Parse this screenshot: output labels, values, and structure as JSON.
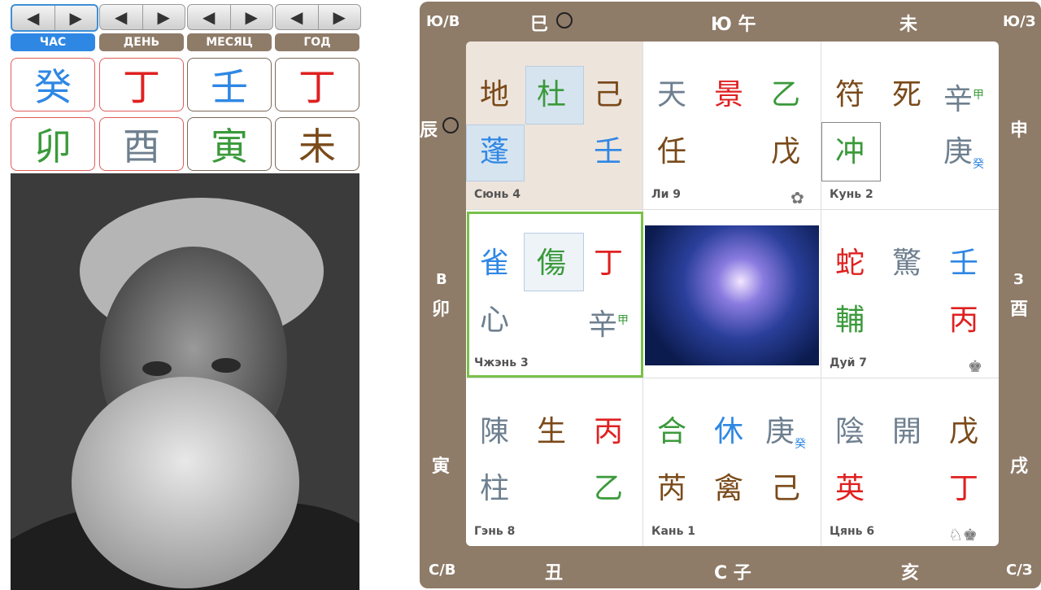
{
  "controls": {
    "tabs": [
      "ЧАС",
      "ДЕНЬ",
      "МЕСЯЦ",
      "ГОД"
    ],
    "arrow_left": "◀",
    "arrow_right": "▶",
    "stems": [
      {
        "ch": "癸",
        "color": "#2f87e4"
      },
      {
        "ch": "丁",
        "color": "#e02020"
      },
      {
        "ch": "壬",
        "color": "#2f87e4"
      },
      {
        "ch": "丁",
        "color": "#e02020"
      }
    ],
    "branches": [
      {
        "ch": "卯",
        "color": "#3a9a3a"
      },
      {
        "ch": "酉",
        "color": "#6e7f8f"
      },
      {
        "ch": "寅",
        "color": "#3a9a3a"
      },
      {
        "ch": "未",
        "color": "#7a4a1a"
      }
    ]
  },
  "board": {
    "corners": {
      "tl": "Ю/В",
      "tr": "Ю/З",
      "bl": "С/В",
      "br": "С/З"
    },
    "top": [
      "巳",
      "Ю 午",
      "未"
    ],
    "bottom": [
      "丑",
      "С 子",
      "亥"
    ],
    "left": [
      "辰",
      "В",
      "卯",
      "寅"
    ],
    "right": [
      "申",
      "З",
      "酉",
      "戌"
    ]
  },
  "cells": [
    {
      "label": "Сюнь 4",
      "g": [
        [
          "地",
          "#7a4a1a"
        ],
        [
          "杜",
          "#3a9a3a"
        ],
        [
          "己",
          "#7a4a1a"
        ],
        [
          "蓬",
          "#2f87e4"
        ],
        [
          "",
          ""
        ],
        [
          "壬",
          "#2f87e4"
        ]
      ]
    },
    {
      "label": "Ли 9",
      "g": [
        [
          "天",
          "#6e7f8f"
        ],
        [
          "景",
          "#e02020"
        ],
        [
          "乙",
          "#3a9a3a"
        ],
        [
          "任",
          "#7a4a1a"
        ],
        [
          "",
          ""
        ],
        [
          "戊",
          "#7a4a1a"
        ]
      ]
    },
    {
      "label": "Кунь 2",
      "g": [
        [
          "符",
          "#7a4a1a"
        ],
        [
          "死",
          "#7a4a1a"
        ],
        [
          "辛",
          "#6e7f8f"
        ],
        [
          "冲",
          "#3a9a3a"
        ],
        [
          "",
          ""
        ],
        [
          "庚",
          "#6e7f8f"
        ]
      ],
      "sup2": "甲",
      "sub5": "癸"
    },
    {
      "label": "Чжэнь 3",
      "g": [
        [
          "雀",
          "#2f87e4"
        ],
        [
          "傷",
          "#3a9a3a"
        ],
        [
          "丁",
          "#e02020"
        ],
        [
          "心",
          "#6e7f8f"
        ],
        [
          "",
          ""
        ],
        [
          "辛",
          "#6e7f8f"
        ]
      ],
      "sup5": "甲"
    },
    {
      "label": "",
      "g": []
    },
    {
      "label": "Дуй 7",
      "g": [
        [
          "蛇",
          "#e02020"
        ],
        [
          "驚",
          "#6e7f8f"
        ],
        [
          "壬",
          "#2f87e4"
        ],
        [
          "輔",
          "#3a9a3a"
        ],
        [
          "",
          ""
        ],
        [
          "丙",
          "#e02020"
        ]
      ]
    },
    {
      "label": "Гэнь 8",
      "g": [
        [
          "陳",
          "#6e7f8f"
        ],
        [
          "生",
          "#7a4a1a"
        ],
        [
          "丙",
          "#e02020"
        ],
        [
          "柱",
          "#6e7f8f"
        ],
        [
          "",
          ""
        ],
        [
          "乙",
          "#3a9a3a"
        ]
      ]
    },
    {
      "label": "Кань 1",
      "g": [
        [
          "合",
          "#3a9a3a"
        ],
        [
          "休",
          "#2f87e4"
        ],
        [
          "庚",
          "#6e7f8f"
        ],
        [
          "芮",
          "#7a4a1a"
        ],
        [
          "禽",
          "#7a4a1a"
        ],
        [
          "己",
          "#7a4a1a"
        ]
      ],
      "sub2": "癸"
    },
    {
      "label": "Цянь 6",
      "g": [
        [
          "陰",
          "#6e7f8f"
        ],
        [
          "開",
          "#6e7f8f"
        ],
        [
          "戊",
          "#7a4a1a"
        ],
        [
          "英",
          "#e02020"
        ],
        [
          "",
          ""
        ],
        [
          "丁",
          "#e02020"
        ]
      ]
    }
  ],
  "icons": {
    "li": "✿",
    "dui": "♚",
    "qian": "♘♚"
  }
}
